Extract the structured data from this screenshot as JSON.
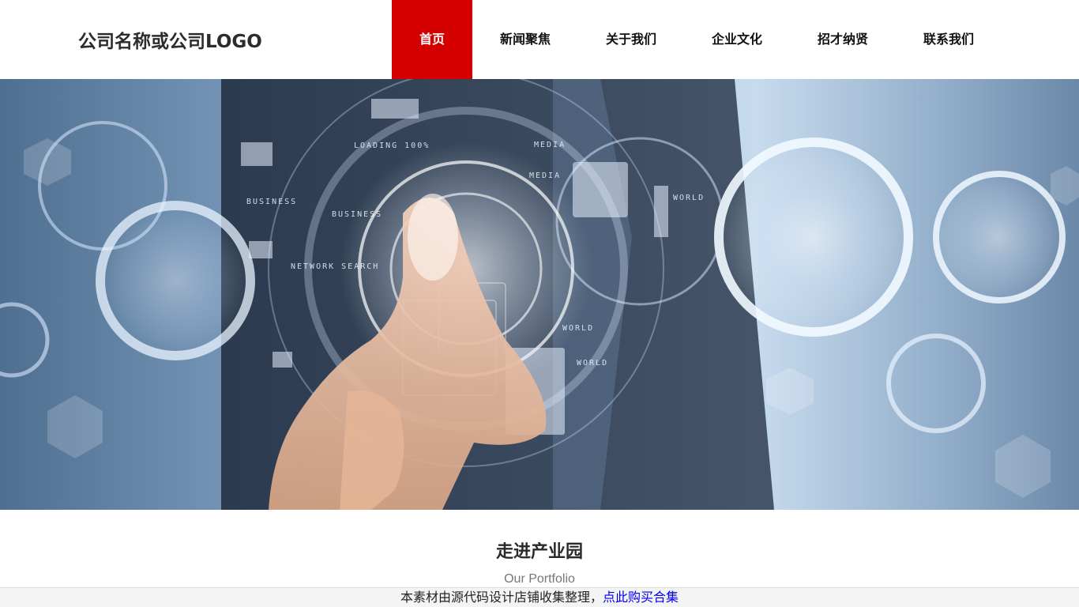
{
  "header": {
    "logo_text": "公司名称或公司LOGO",
    "nav": [
      {
        "label": "首页",
        "active": true
      },
      {
        "label": "新闻聚焦",
        "active": false
      },
      {
        "label": "关于我们",
        "active": false
      },
      {
        "label": "企业文化",
        "active": false
      },
      {
        "label": "招才纳贤",
        "active": false
      },
      {
        "label": "联系我们",
        "active": false
      }
    ]
  },
  "banner": {
    "overlay_labels": [
      "BUSINESS",
      "BUSINESS",
      "NETWORK SEARCH",
      "LOADING 100%",
      "MEDIA",
      "MEDIA",
      "WORLD",
      "WORLD",
      "WORLD"
    ]
  },
  "section": {
    "title": "走进产业园",
    "subtitle": "Our Portfolio"
  },
  "footer_bar": {
    "text": "本素材由源代码设计店铺收集整理，",
    "link_text": "点此购买合集"
  },
  "colors": {
    "accent": "#d40000",
    "link": "#0000ee"
  }
}
